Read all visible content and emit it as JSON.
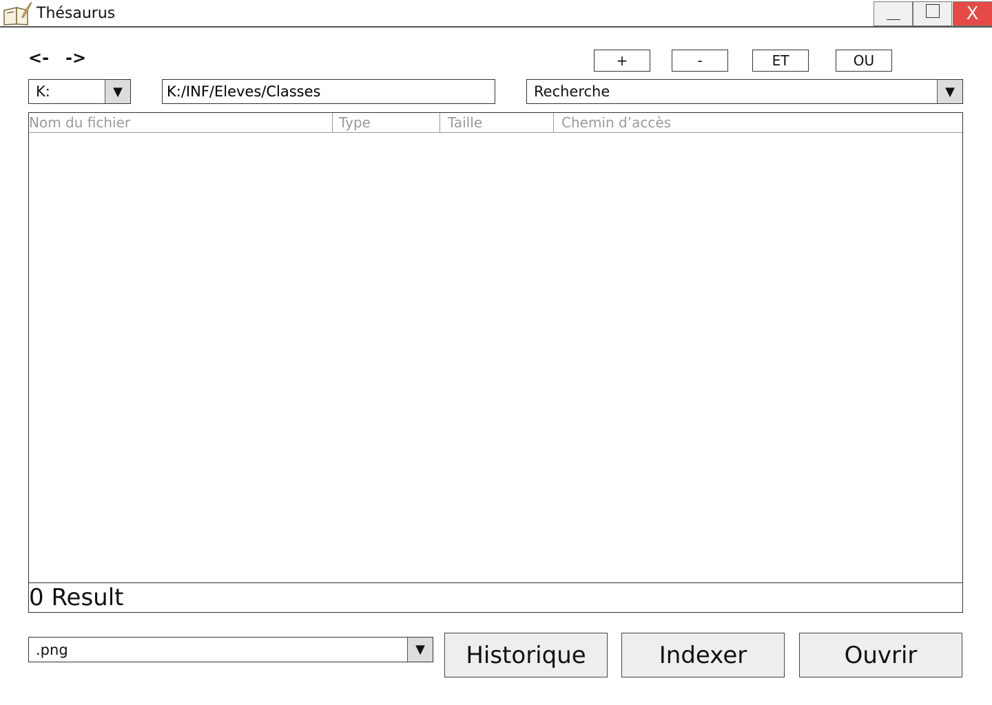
{
  "window": {
    "title": "Thésaurus",
    "controls": {
      "minimize": "",
      "maximize": "",
      "close": "X"
    }
  },
  "nav": {
    "back": "<-",
    "forward": "->"
  },
  "operators": {
    "add": "+",
    "remove": "-",
    "and": "ET",
    "or": "OU"
  },
  "drive": {
    "selected": "K:"
  },
  "path": {
    "value": "K:/INF/Eleves/Classes"
  },
  "search": {
    "selected": "Recherche"
  },
  "results": {
    "columns": [
      "Nom du fichier",
      "Type",
      "Taille",
      "Chemin d’accès"
    ],
    "rows": [],
    "count_text": "0 Result"
  },
  "extension": {
    "selected": ".png"
  },
  "actions": {
    "history": "Historique",
    "index": "Indexer",
    "open": "Ouvrir"
  },
  "icons": {
    "app": "book-quill-icon",
    "dropdown": "triangle-down-icon"
  },
  "colors": {
    "close_button": "#e64a46",
    "header_text": "#9a9a9a",
    "button_bg": "#eeeeee"
  }
}
